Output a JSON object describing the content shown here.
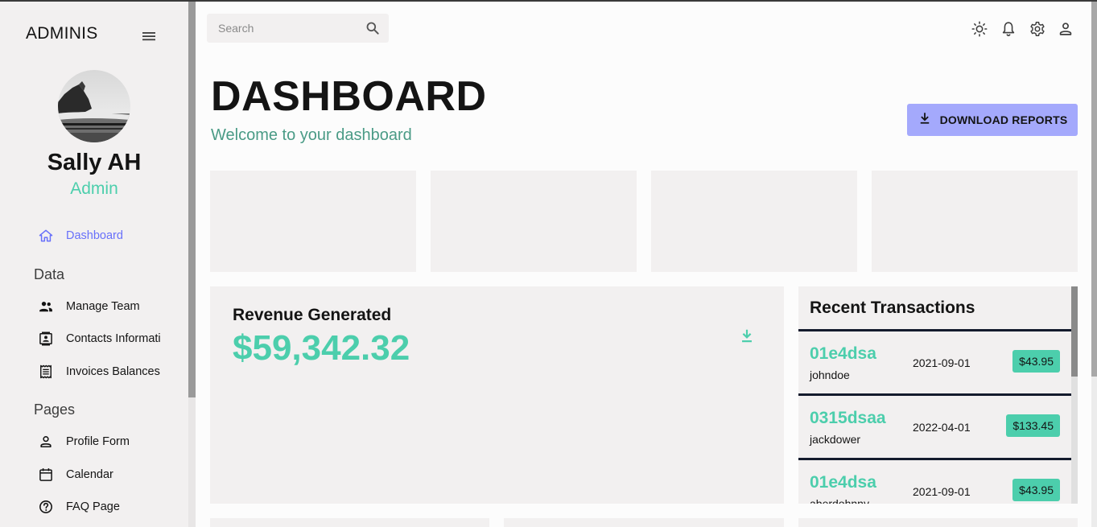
{
  "sidebar": {
    "brand": "ADMINIS",
    "user_name": "Sally AH",
    "user_role": "Admin",
    "nav": [
      {
        "label": "Dashboard",
        "icon": "home-icon",
        "active": true
      },
      {
        "section": "Data"
      },
      {
        "label": "Manage Team",
        "icon": "people-icon"
      },
      {
        "label": "Contacts Informati",
        "icon": "contacts-icon"
      },
      {
        "label": "Invoices Balances",
        "icon": "receipt-icon"
      },
      {
        "section": "Pages"
      },
      {
        "label": "Profile Form",
        "icon": "person-icon"
      },
      {
        "label": "Calendar",
        "icon": "calendar-icon"
      },
      {
        "label": "FAQ Page",
        "icon": "help-icon"
      }
    ]
  },
  "topbar": {
    "search_placeholder": "Search",
    "icons": [
      "light-mode-icon",
      "notifications-icon",
      "settings-icon",
      "person-icon"
    ]
  },
  "header": {
    "title": "DASHBOARD",
    "subtitle": "Welcome to your dashboard",
    "download_label": "DOWNLOAD REPORTS"
  },
  "revenue": {
    "title": "Revenue Generated",
    "value": "$59,342.32"
  },
  "transactions": {
    "title": "Recent Transactions",
    "rows": [
      {
        "id": "01e4dsa",
        "user": "johndoe",
        "date": "2021-09-01",
        "cost": "$43.95"
      },
      {
        "id": "0315dsaa",
        "user": "jackdower",
        "date": "2022-04-01",
        "cost": "$133.45"
      },
      {
        "id": "01e4dsa",
        "user": "aberdohnny",
        "date": "2021-09-01",
        "cost": "$43.95"
      }
    ]
  },
  "colors": {
    "accent_green": "#4cceac",
    "accent_blue": "#6870fa",
    "button_bg": "#a4a9fc",
    "panel_bg": "#f2f0f0",
    "divider": "#141b2d"
  }
}
